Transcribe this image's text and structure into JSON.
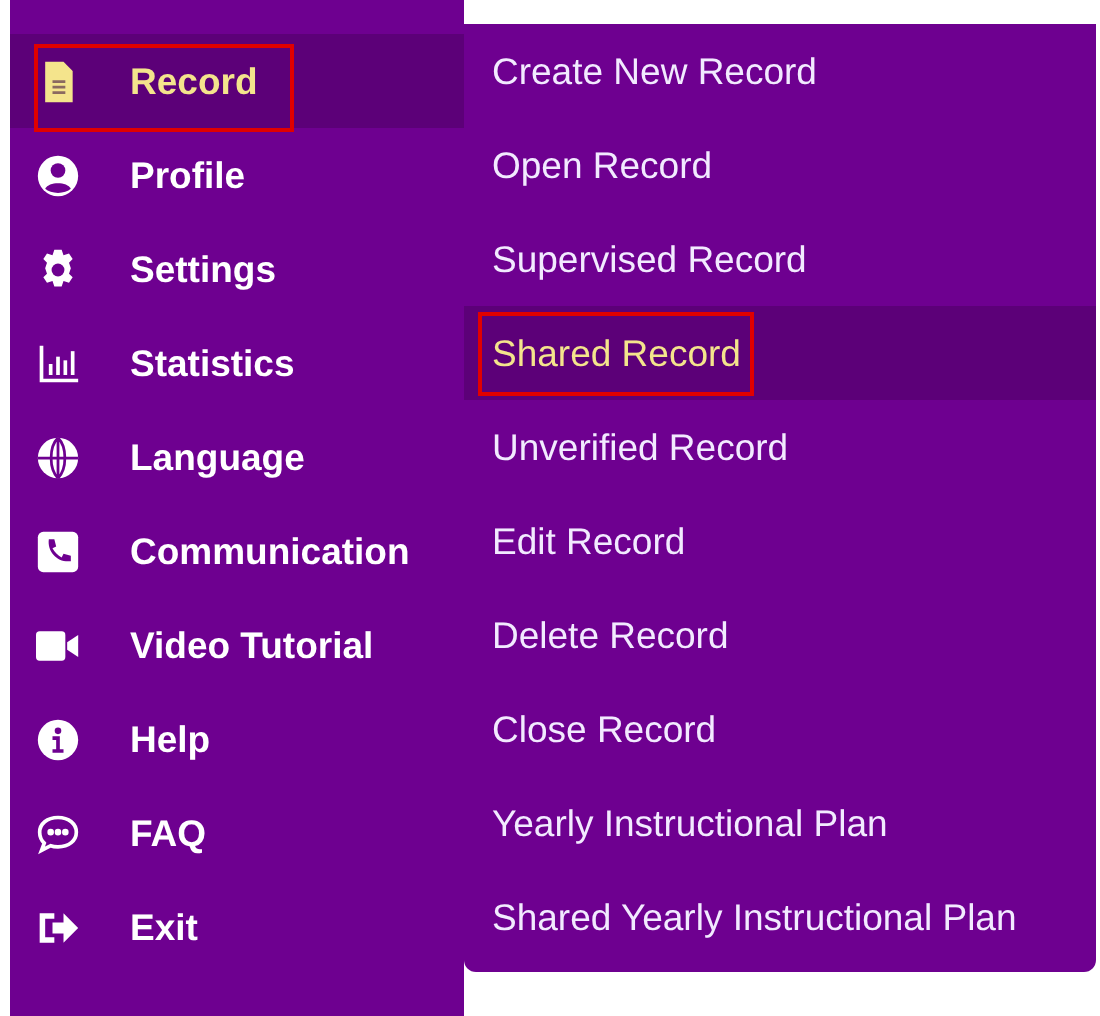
{
  "sidebar": {
    "items": [
      {
        "label": "Record",
        "selected": true,
        "outlined": true
      },
      {
        "label": "Profile",
        "selected": false,
        "outlined": false
      },
      {
        "label": "Settings",
        "selected": false,
        "outlined": false
      },
      {
        "label": "Statistics",
        "selected": false,
        "outlined": false
      },
      {
        "label": "Language",
        "selected": false,
        "outlined": false
      },
      {
        "label": "Communication",
        "selected": false,
        "outlined": false
      },
      {
        "label": "Video Tutorial",
        "selected": false,
        "outlined": false
      },
      {
        "label": "Help",
        "selected": false,
        "outlined": false
      },
      {
        "label": "FAQ",
        "selected": false,
        "outlined": false
      },
      {
        "label": "Exit",
        "selected": false,
        "outlined": false
      }
    ]
  },
  "submenu": {
    "items": [
      {
        "label": "Create New Record",
        "selected": false,
        "outlined": false
      },
      {
        "label": "Open Record",
        "selected": false,
        "outlined": false
      },
      {
        "label": "Supervised Record",
        "selected": false,
        "outlined": false
      },
      {
        "label": "Shared Record",
        "selected": true,
        "outlined": true
      },
      {
        "label": "Unverified Record",
        "selected": false,
        "outlined": false
      },
      {
        "label": "Edit Record",
        "selected": false,
        "outlined": false
      },
      {
        "label": "Delete Record",
        "selected": false,
        "outlined": false
      },
      {
        "label": "Close Record",
        "selected": false,
        "outlined": false
      },
      {
        "label": "Yearly Instructional Plan",
        "selected": false,
        "outlined": false
      },
      {
        "label": "Shared Yearly Instructional Plan",
        "selected": false,
        "outlined": false
      }
    ]
  }
}
